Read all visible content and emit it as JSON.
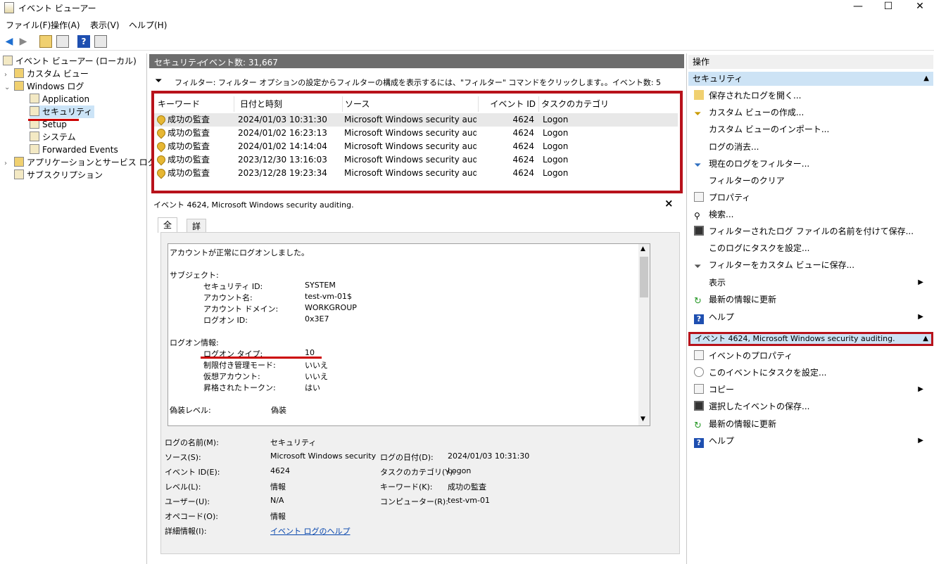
{
  "window": {
    "title": "イベント ビューアー",
    "minimize": "—",
    "maximize": "☐",
    "close": "✕"
  },
  "menu": [
    "ファイル(F)",
    "操作(A)",
    "表示(V)",
    "ヘルプ(H)"
  ],
  "tree": {
    "root": "イベント ビューアー (ローカル)",
    "custom_views": "カスタム ビュー",
    "windows_logs": "Windows ログ",
    "logs": [
      "Application",
      "セキュリティ",
      "Setup",
      "システム",
      "Forwarded Events"
    ],
    "apps_services": "アプリケーションとサービス ログ",
    "subscriptions": "サブスクリプション"
  },
  "center": {
    "log_name": "セキュリティ",
    "event_count": "イベント数: 31,667",
    "filter_text": "フィルター: フィルター オプションの設定からフィルターの構成を表示するには、\"フィルター\" コマンドをクリックします。。イベント数: 5"
  },
  "grid": {
    "headers": [
      "キーワード",
      "日付と時刻",
      "ソース",
      "イベント ID",
      "タスクのカテゴリ"
    ],
    "rows": [
      {
        "keyword": "成功の監査",
        "datetime": "2024/01/03 10:31:30",
        "source": "Microsoft Windows security audi...",
        "id": "4624",
        "task": "Logon"
      },
      {
        "keyword": "成功の監査",
        "datetime": "2024/01/02 16:23:13",
        "source": "Microsoft Windows security audi...",
        "id": "4624",
        "task": "Logon"
      },
      {
        "keyword": "成功の監査",
        "datetime": "2024/01/02 14:14:04",
        "source": "Microsoft Windows security audi...",
        "id": "4624",
        "task": "Logon"
      },
      {
        "keyword": "成功の監査",
        "datetime": "2023/12/30 13:16:03",
        "source": "Microsoft Windows security audi...",
        "id": "4624",
        "task": "Logon"
      },
      {
        "keyword": "成功の監査",
        "datetime": "2023/12/28 19:23:34",
        "source": "Microsoft Windows security audi...",
        "id": "4624",
        "task": "Logon"
      }
    ]
  },
  "detail": {
    "title": "イベント 4624, Microsoft Windows security auditing.",
    "close": "×",
    "tabs": [
      "全般",
      "詳細"
    ],
    "message": {
      "intro": "アカウントが正常にログオンしました。",
      "subject": "サブジェクト:",
      "security_id_label": "セキュリティ ID:",
      "security_id": "SYSTEM",
      "account_name_label": "アカウント名:",
      "account_name": "test-vm-01$",
      "account_domain_label": "アカウント ドメイン:",
      "account_domain": "WORKGROUP",
      "logon_id_label": "ログオン ID:",
      "logon_id": "0x3E7",
      "logon_info": "ログオン情報:",
      "logon_type_label": "ログオン タイプ:",
      "logon_type": "10",
      "restricted_label": "制限付き管理モード:",
      "restricted": "いいえ",
      "virtual_label": "仮想アカウント:",
      "virtual": "いいえ",
      "elevated_label": "昇格されたトークン:",
      "elevated": "はい",
      "impersonation_label": "偽装レベル:",
      "impersonation": "偽装"
    },
    "props": {
      "log_name_label": "ログの名前(M):",
      "log_name": "セキュリティ",
      "source_label": "ソース(S):",
      "source": "Microsoft Windows security a",
      "logged_label": "ログの日付(D):",
      "logged": "2024/01/03 10:31:30",
      "event_id_label": "イベント ID(E):",
      "event_id": "4624",
      "task_label": "タスクのカテゴリ(Y):",
      "task": "Logon",
      "level_label": "レベル(L):",
      "level": "情報",
      "keyword_label": "キーワード(K):",
      "keyword": "成功の監査",
      "user_label": "ユーザー(U):",
      "user": "N/A",
      "computer_label": "コンピューター(R):",
      "computer": "test-vm-01",
      "opcode_label": "オペコード(O):",
      "opcode": "情報",
      "more_label": "詳細情報(I):",
      "more_link": "イベント ログのヘルプ"
    }
  },
  "actions": {
    "title": "操作",
    "section1": "セキュリティ",
    "items1": [
      "保存されたログを開く...",
      "カスタム ビューの作成...",
      "カスタム ビューのインポート...",
      "ログの消去...",
      "現在のログをフィルター...",
      "フィルターのクリア",
      "プロパティ",
      "検索...",
      "フィルターされたログ ファイルの名前を付けて保存...",
      "このログにタスクを設定...",
      "フィルターをカスタム ビューに保存...",
      "表示",
      "最新の情報に更新",
      "ヘルプ"
    ],
    "section2": "イベント 4624, Microsoft Windows security auditing.",
    "items2": [
      "イベントのプロパティ",
      "このイベントにタスクを設定...",
      "コピー",
      "選択したイベントの保存...",
      "最新の情報に更新",
      "ヘルプ"
    ]
  }
}
